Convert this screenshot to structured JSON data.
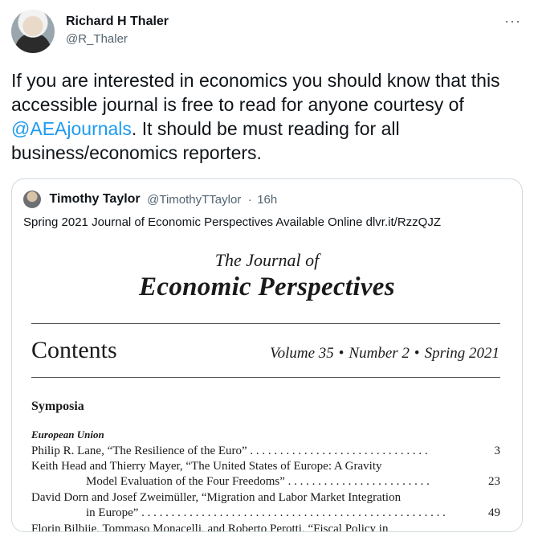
{
  "tweet": {
    "author_name": "Richard H Thaler",
    "author_handle": "@R_Thaler",
    "more_icon": "more-options-icon",
    "text_before": "If you are interested in economics you should know that this accessible journal is free to read for anyone courtesy of ",
    "mention": "@AEAjournals",
    "text_after": ". It should be must reading for all business/economics reporters."
  },
  "quote": {
    "author_name": "Timothy Taylor",
    "author_handle": "@TimothyTTaylor",
    "separator": "·",
    "time": "16h",
    "text": "Spring 2021 Journal of Economic Perspectives Available Online dlvr.it/RzzQJZ"
  },
  "journal": {
    "the_line": "The Journal of",
    "title": "Economic Perspectives",
    "contents": "Contents",
    "volume": "Volume 35",
    "number": "Number 2",
    "season": "Spring 2021",
    "bullet": "•",
    "symposia": "Symposia",
    "section": "European Union",
    "toc": [
      {
        "text": "Philip R. Lane, “The Resilience of the Euro” . . . . . . . . . . . . . . . . . . . . . . . . . . . . . .",
        "page": "3"
      },
      {
        "text": "Keith Head and Thierry Mayer, “The United States of Europe: A Gravity",
        "page": ""
      },
      {
        "text": "Model Evaluation of the Four Freedoms” . . . . . . . . . . . . . . . . . . . . . . . .",
        "page": "23"
      },
      {
        "text": "David Dorn and Josef Zweimüller, “Migration and Labor Market Integration",
        "page": ""
      },
      {
        "text": "in Europe” . . . . . . . . . . . . . . . . . . . . . . . . . . . . . . . . . . . . . . . . . . . . . . . . . . .",
        "page": "49"
      },
      {
        "text": "Florin Bilbiie, Tommaso Monacelli, and Roberto Perotti, “Fiscal Policy in",
        "page": ""
      }
    ]
  }
}
